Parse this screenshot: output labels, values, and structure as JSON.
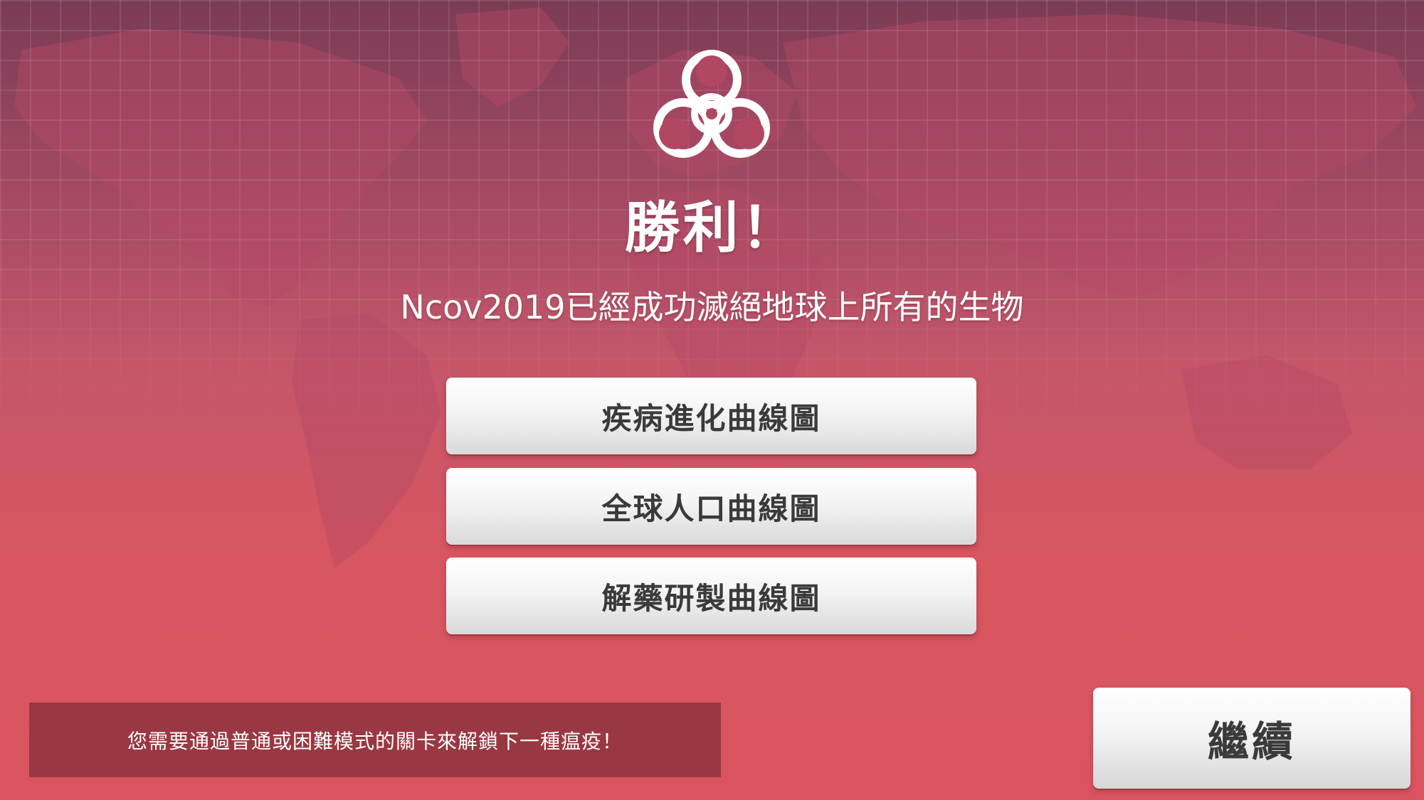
{
  "screen": {
    "title": "勝利！",
    "message": "Ncov2019已經成功滅絕地球上所有的生物"
  },
  "graph_buttons": [
    {
      "label": "疾病進化曲線圖"
    },
    {
      "label": "全球人口曲線圖"
    },
    {
      "label": "解藥研製曲線圖"
    }
  ],
  "notice": {
    "text": "您需要通過普通或困難模式的關卡來解鎖下一種瘟疫！"
  },
  "continue_button": {
    "label": "繼續"
  },
  "icons": {
    "header": "biohazard-icon"
  },
  "colors": {
    "background_top": "#7a3b55",
    "background_bottom": "#da5460",
    "notice_bg": "#993842",
    "button_text": "#3a3a3a"
  }
}
